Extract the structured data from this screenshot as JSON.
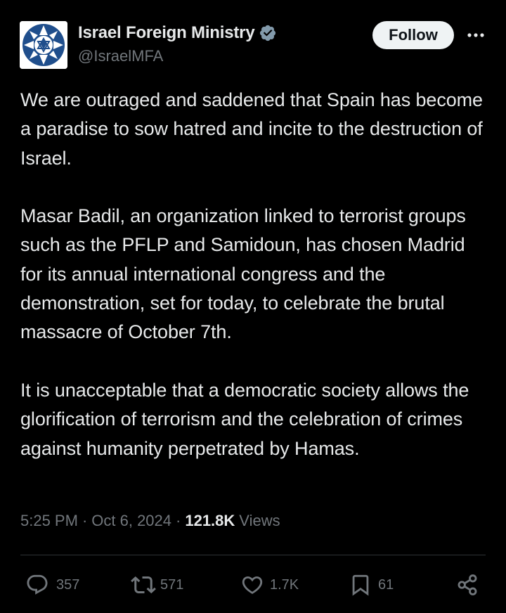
{
  "author": {
    "display_name": "Israel Foreign Ministry",
    "handle": "@IsraelMFA",
    "verified": true,
    "avatar_icon": "israel-mfa-logo-icon",
    "verified_icon": "verified-badge-icon"
  },
  "header": {
    "follow_label": "Follow",
    "more_icon": "more-dots-icon"
  },
  "tweet": {
    "paragraphs": [
      "We are outraged and saddened that Spain has become a paradise to sow hatred and incite to the destruction of Israel.",
      "Masar Badil, an organization linked to terrorist groups such as the PFLP and Samidoun, has chosen Madrid for its annual international congress and the demonstration, set for today, to celebrate the brutal massacre of October 7th.",
      "It is unacceptable that a democratic society allows the glorification of terrorism and the celebration of crimes against humanity perpetrated by Hamas."
    ]
  },
  "meta": {
    "time": "5:25 PM",
    "separator": "·",
    "date": "Oct 6, 2024",
    "views_count": "121.8K",
    "views_label": "Views"
  },
  "actions": {
    "replies": "357",
    "reposts": "571",
    "likes": "1.7K",
    "bookmarks": "61"
  },
  "colors": {
    "background": "#000000",
    "primary_text": "#e7e9ea",
    "secondary_text": "#71767b",
    "verified": "#829aab",
    "divider": "#2f3336",
    "avatar_blue": "#1f4e8c"
  }
}
